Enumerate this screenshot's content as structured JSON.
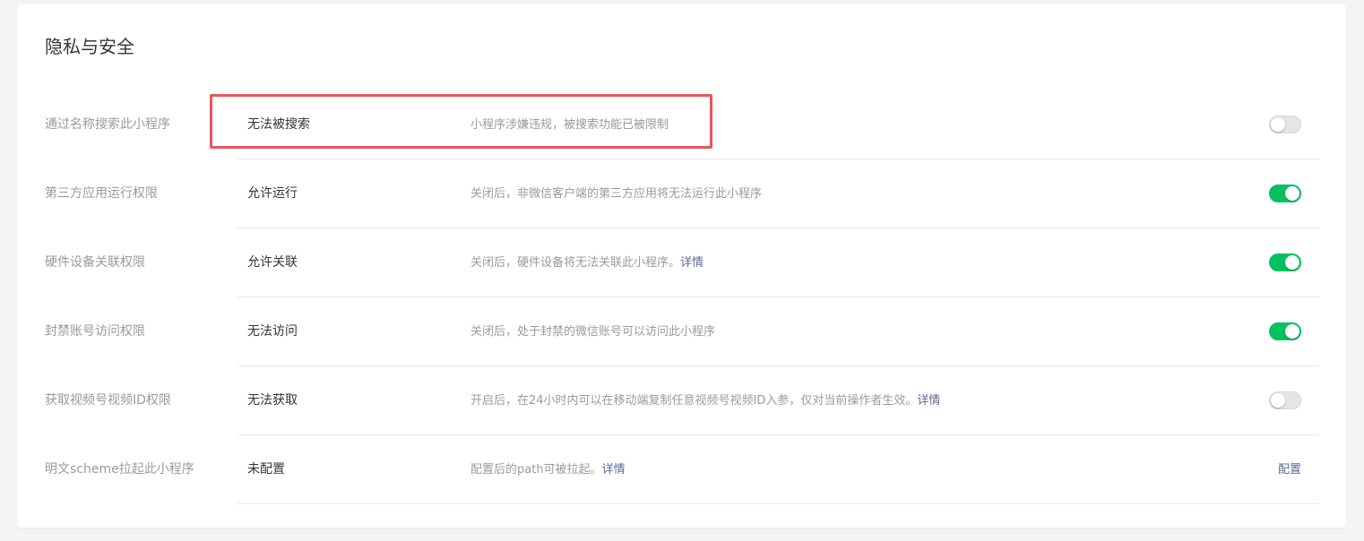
{
  "section": {
    "title": "隐私与安全"
  },
  "rows": [
    {
      "label": "通过名称搜索此小程序",
      "status": "无法被搜索",
      "description": "小程序涉嫌违规，被搜索功能已被限制",
      "detail_link": "",
      "control": "toggle",
      "toggle_on": false
    },
    {
      "label": "第三方应用运行权限",
      "status": "允许运行",
      "description": "关闭后，非微信客户端的第三方应用将无法运行此小程序",
      "detail_link": "",
      "control": "toggle",
      "toggle_on": true
    },
    {
      "label": "硬件设备关联权限",
      "status": "允许关联",
      "description": "关闭后，硬件设备将无法关联此小程序。",
      "detail_link": "详情",
      "control": "toggle",
      "toggle_on": true
    },
    {
      "label": "封禁账号访问权限",
      "status": "无法访问",
      "description": "关闭后，处于封禁的微信账号可以访问此小程序",
      "detail_link": "",
      "control": "toggle",
      "toggle_on": true
    },
    {
      "label": "获取视频号视频ID权限",
      "status": "无法获取",
      "description": "开启后，在24小时内可以在移动端复制任意视频号视频ID入参，仅对当前操作者生效。",
      "detail_link": "详情",
      "control": "toggle",
      "toggle_on": false
    },
    {
      "label": "明文scheme拉起此小程序",
      "status": "未配置",
      "description": "配置后的path可被拉起。",
      "detail_link": "详情",
      "control": "link",
      "action_label": "配置"
    }
  ],
  "colors": {
    "toggle_on": "#07c160",
    "toggle_off": "#e5e5e5",
    "link": "#576b95",
    "highlight": "#e8565a"
  }
}
